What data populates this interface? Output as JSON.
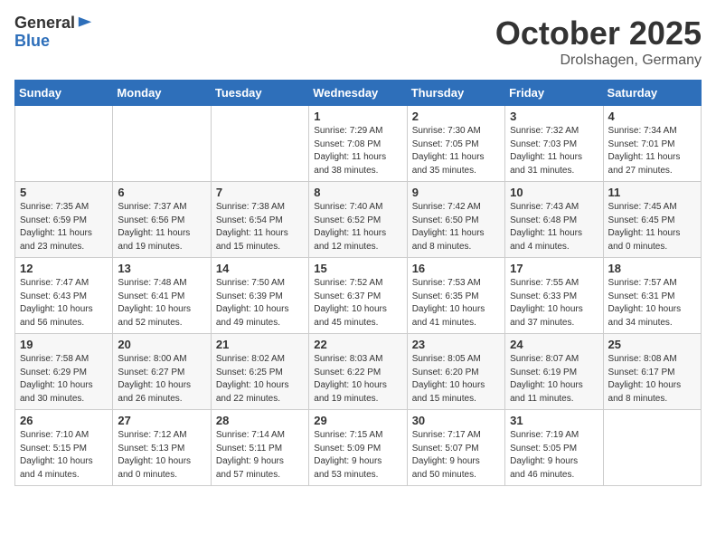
{
  "header": {
    "logo_general": "General",
    "logo_blue": "Blue",
    "title": "October 2025",
    "location": "Drolshagen, Germany"
  },
  "weekdays": [
    "Sunday",
    "Monday",
    "Tuesday",
    "Wednesday",
    "Thursday",
    "Friday",
    "Saturday"
  ],
  "weeks": [
    [
      {
        "day": "",
        "info": ""
      },
      {
        "day": "",
        "info": ""
      },
      {
        "day": "",
        "info": ""
      },
      {
        "day": "1",
        "info": "Sunrise: 7:29 AM\nSunset: 7:08 PM\nDaylight: 11 hours\nand 38 minutes."
      },
      {
        "day": "2",
        "info": "Sunrise: 7:30 AM\nSunset: 7:05 PM\nDaylight: 11 hours\nand 35 minutes."
      },
      {
        "day": "3",
        "info": "Sunrise: 7:32 AM\nSunset: 7:03 PM\nDaylight: 11 hours\nand 31 minutes."
      },
      {
        "day": "4",
        "info": "Sunrise: 7:34 AM\nSunset: 7:01 PM\nDaylight: 11 hours\nand 27 minutes."
      }
    ],
    [
      {
        "day": "5",
        "info": "Sunrise: 7:35 AM\nSunset: 6:59 PM\nDaylight: 11 hours\nand 23 minutes."
      },
      {
        "day": "6",
        "info": "Sunrise: 7:37 AM\nSunset: 6:56 PM\nDaylight: 11 hours\nand 19 minutes."
      },
      {
        "day": "7",
        "info": "Sunrise: 7:38 AM\nSunset: 6:54 PM\nDaylight: 11 hours\nand 15 minutes."
      },
      {
        "day": "8",
        "info": "Sunrise: 7:40 AM\nSunset: 6:52 PM\nDaylight: 11 hours\nand 12 minutes."
      },
      {
        "day": "9",
        "info": "Sunrise: 7:42 AM\nSunset: 6:50 PM\nDaylight: 11 hours\nand 8 minutes."
      },
      {
        "day": "10",
        "info": "Sunrise: 7:43 AM\nSunset: 6:48 PM\nDaylight: 11 hours\nand 4 minutes."
      },
      {
        "day": "11",
        "info": "Sunrise: 7:45 AM\nSunset: 6:45 PM\nDaylight: 11 hours\nand 0 minutes."
      }
    ],
    [
      {
        "day": "12",
        "info": "Sunrise: 7:47 AM\nSunset: 6:43 PM\nDaylight: 10 hours\nand 56 minutes."
      },
      {
        "day": "13",
        "info": "Sunrise: 7:48 AM\nSunset: 6:41 PM\nDaylight: 10 hours\nand 52 minutes."
      },
      {
        "day": "14",
        "info": "Sunrise: 7:50 AM\nSunset: 6:39 PM\nDaylight: 10 hours\nand 49 minutes."
      },
      {
        "day": "15",
        "info": "Sunrise: 7:52 AM\nSunset: 6:37 PM\nDaylight: 10 hours\nand 45 minutes."
      },
      {
        "day": "16",
        "info": "Sunrise: 7:53 AM\nSunset: 6:35 PM\nDaylight: 10 hours\nand 41 minutes."
      },
      {
        "day": "17",
        "info": "Sunrise: 7:55 AM\nSunset: 6:33 PM\nDaylight: 10 hours\nand 37 minutes."
      },
      {
        "day": "18",
        "info": "Sunrise: 7:57 AM\nSunset: 6:31 PM\nDaylight: 10 hours\nand 34 minutes."
      }
    ],
    [
      {
        "day": "19",
        "info": "Sunrise: 7:58 AM\nSunset: 6:29 PM\nDaylight: 10 hours\nand 30 minutes."
      },
      {
        "day": "20",
        "info": "Sunrise: 8:00 AM\nSunset: 6:27 PM\nDaylight: 10 hours\nand 26 minutes."
      },
      {
        "day": "21",
        "info": "Sunrise: 8:02 AM\nSunset: 6:25 PM\nDaylight: 10 hours\nand 22 minutes."
      },
      {
        "day": "22",
        "info": "Sunrise: 8:03 AM\nSunset: 6:22 PM\nDaylight: 10 hours\nand 19 minutes."
      },
      {
        "day": "23",
        "info": "Sunrise: 8:05 AM\nSunset: 6:20 PM\nDaylight: 10 hours\nand 15 minutes."
      },
      {
        "day": "24",
        "info": "Sunrise: 8:07 AM\nSunset: 6:19 PM\nDaylight: 10 hours\nand 11 minutes."
      },
      {
        "day": "25",
        "info": "Sunrise: 8:08 AM\nSunset: 6:17 PM\nDaylight: 10 hours\nand 8 minutes."
      }
    ],
    [
      {
        "day": "26",
        "info": "Sunrise: 7:10 AM\nSunset: 5:15 PM\nDaylight: 10 hours\nand 4 minutes."
      },
      {
        "day": "27",
        "info": "Sunrise: 7:12 AM\nSunset: 5:13 PM\nDaylight: 10 hours\nand 0 minutes."
      },
      {
        "day": "28",
        "info": "Sunrise: 7:14 AM\nSunset: 5:11 PM\nDaylight: 9 hours\nand 57 minutes."
      },
      {
        "day": "29",
        "info": "Sunrise: 7:15 AM\nSunset: 5:09 PM\nDaylight: 9 hours\nand 53 minutes."
      },
      {
        "day": "30",
        "info": "Sunrise: 7:17 AM\nSunset: 5:07 PM\nDaylight: 9 hours\nand 50 minutes."
      },
      {
        "day": "31",
        "info": "Sunrise: 7:19 AM\nSunset: 5:05 PM\nDaylight: 9 hours\nand 46 minutes."
      },
      {
        "day": "",
        "info": ""
      }
    ]
  ]
}
